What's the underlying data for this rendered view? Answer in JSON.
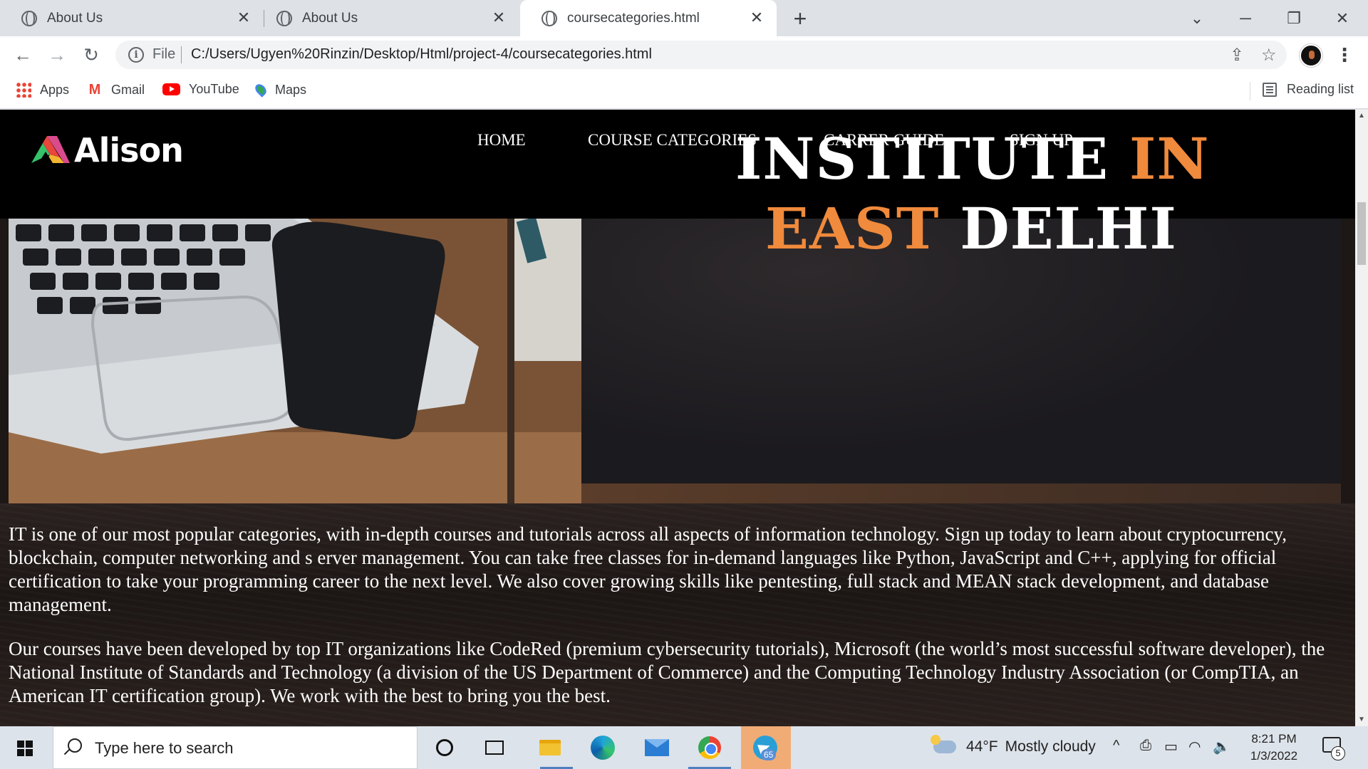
{
  "browser": {
    "tabs": [
      {
        "title": "About Us"
      },
      {
        "title": "About Us"
      },
      {
        "title": "coursecategories.html"
      }
    ],
    "new_tab": "+",
    "address": {
      "scheme_label": "File",
      "url": "C:/Users/Ugyen%20Rinzin/Desktop/Html/project-4/coursecategories.html"
    },
    "bookmarks": [
      {
        "label": "Apps",
        "icon": "apps-grid-icon"
      },
      {
        "label": "Gmail",
        "icon": "gmail-icon"
      },
      {
        "label": "YouTube",
        "icon": "youtube-icon"
      },
      {
        "label": "Maps",
        "icon": "maps-pin-icon"
      }
    ],
    "reading_list": "Reading list"
  },
  "site": {
    "logo_text": "Alison",
    "nav": [
      "HOME",
      "COURSE CATEGORIES",
      "CARRER GUIDE",
      "SIGN UP"
    ],
    "hero": {
      "line1_white": "INSTITUTE ",
      "line1_orange": "IN",
      "line2_orange": "EAST ",
      "line2_white": "DELHI",
      "accent": "#f08a3c"
    },
    "paragraphs": [
      "IT is one of our most popular categories, with in-depth courses and tutorials across all aspects of information technology. Sign up today to learn about cryptocurrency, blockchain, computer networking and s erver management. You can take free classes for in-demand languages like Python, JavaScript and C++, applying for official certification to take your programming career to the next level. We also cover growing skills like pentesting, full stack and MEAN stack development, and database management.",
      "Our courses have been developed by top IT organizations like CodeRed (premium cybersecurity tutorials), Microsoft (the world’s most successful software developer), the National Institute of Standards and Technology (a division of the US Department of Commerce) and the Computing Technology Industry Association (or CompTIA, an American IT certification group). We work with the best to bring you the best."
    ]
  },
  "taskbar": {
    "search_placeholder": "Type here to search",
    "telegram_badge": "65",
    "weather": {
      "temp": "44°F",
      "condition": "Mostly cloudy"
    },
    "clock": {
      "time": "8:21 PM",
      "date": "1/3/2022"
    },
    "notification_count": "5"
  }
}
